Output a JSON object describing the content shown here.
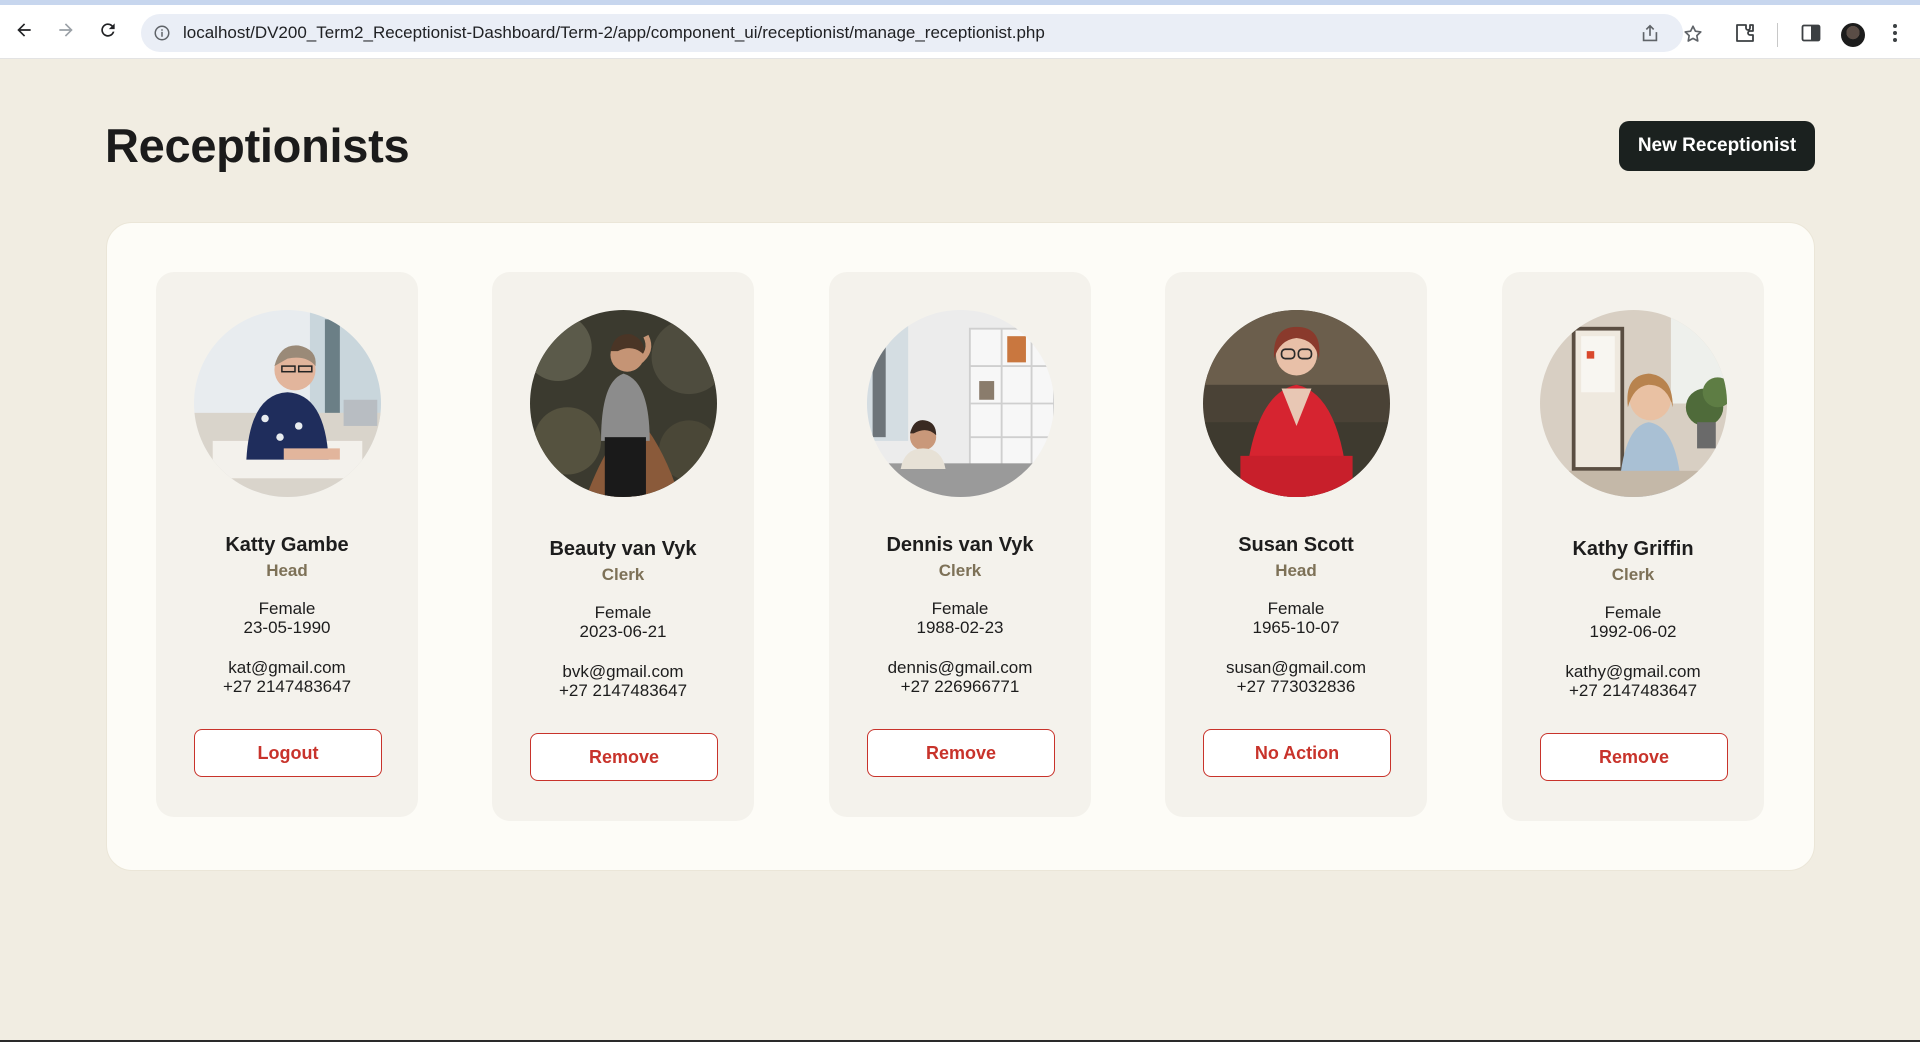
{
  "browser": {
    "url": "localhost/DV200_Term2_Receptionist-Dashboard/Term-2/app/component_ui/receptionist/manage_receptionist.php"
  },
  "page": {
    "title": "Receptionists",
    "new_button_label": "New Receptionist"
  },
  "colors": {
    "background": "#f1ede2",
    "panel": "#fdfcf7",
    "card": "#f4f2ec",
    "accent_red": "#c8332b",
    "role_text": "#7d7157",
    "primary_button": "#1b211f"
  },
  "receptionists": [
    {
      "name": "Katty Gambe",
      "role": "Head",
      "gender": "Female",
      "dob": "23-05-1990",
      "email": "kat@gmail.com",
      "phone": "+27 2147483647",
      "action": "Logout"
    },
    {
      "name": "Beauty van Vyk",
      "role": "Clerk",
      "gender": "Female",
      "dob": "2023-06-21",
      "email": "bvk@gmail.com",
      "phone": "+27 2147483647",
      "action": "Remove"
    },
    {
      "name": "Dennis van Vyk",
      "role": "Clerk",
      "gender": "Female",
      "dob": "1988-02-23",
      "email": "dennis@gmail.com",
      "phone": "+27 226966771",
      "action": "Remove"
    },
    {
      "name": "Susan Scott",
      "role": "Head",
      "gender": "Female",
      "dob": "1965-10-07",
      "email": "susan@gmail.com",
      "phone": "+27 773032836",
      "action": "No Action"
    },
    {
      "name": "Kathy Griffin",
      "role": "Clerk",
      "gender": "Female",
      "dob": "1992-06-02",
      "email": "kathy@gmail.com",
      "phone": "+27 2147483647",
      "action": "Remove"
    }
  ]
}
